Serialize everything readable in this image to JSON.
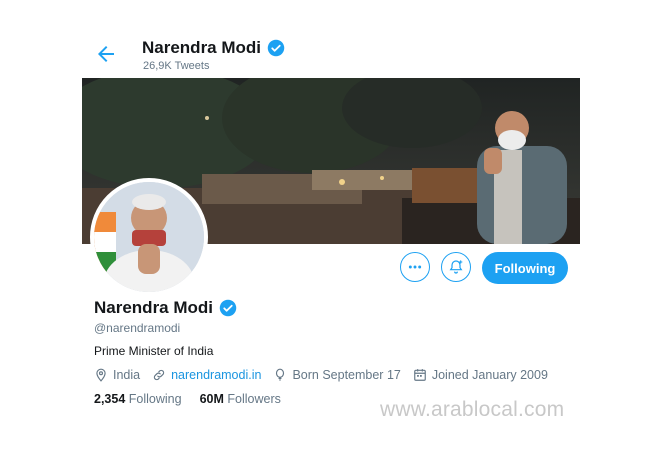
{
  "header": {
    "name": "Narendra Modi",
    "tweet_count": "26,9K Tweets"
  },
  "profile": {
    "name": "Narendra Modi",
    "handle": "@narendramodi",
    "bio": "Prime Minister of India",
    "location": "India",
    "website": "narendramodi.in",
    "birthday": "Born September 17",
    "joined": "Joined January 2009"
  },
  "stats": {
    "following_count": "2,354",
    "following_label": "Following",
    "followers_count": "60M",
    "followers_label": "Followers"
  },
  "actions": {
    "follow_label": "Following"
  },
  "icons": {
    "back": "arrow-left-icon",
    "verified": "verified-badge-icon",
    "more": "more-options-icon",
    "notify": "bell-plus-icon",
    "location": "location-pin-icon",
    "link": "link-icon",
    "birthday": "balloon-icon",
    "calendar": "calendar-icon"
  },
  "watermark": "www.arablocal.com",
  "colors": {
    "accent": "#1da1f2",
    "link": "#1b95e0",
    "secondary_text": "#657786"
  }
}
